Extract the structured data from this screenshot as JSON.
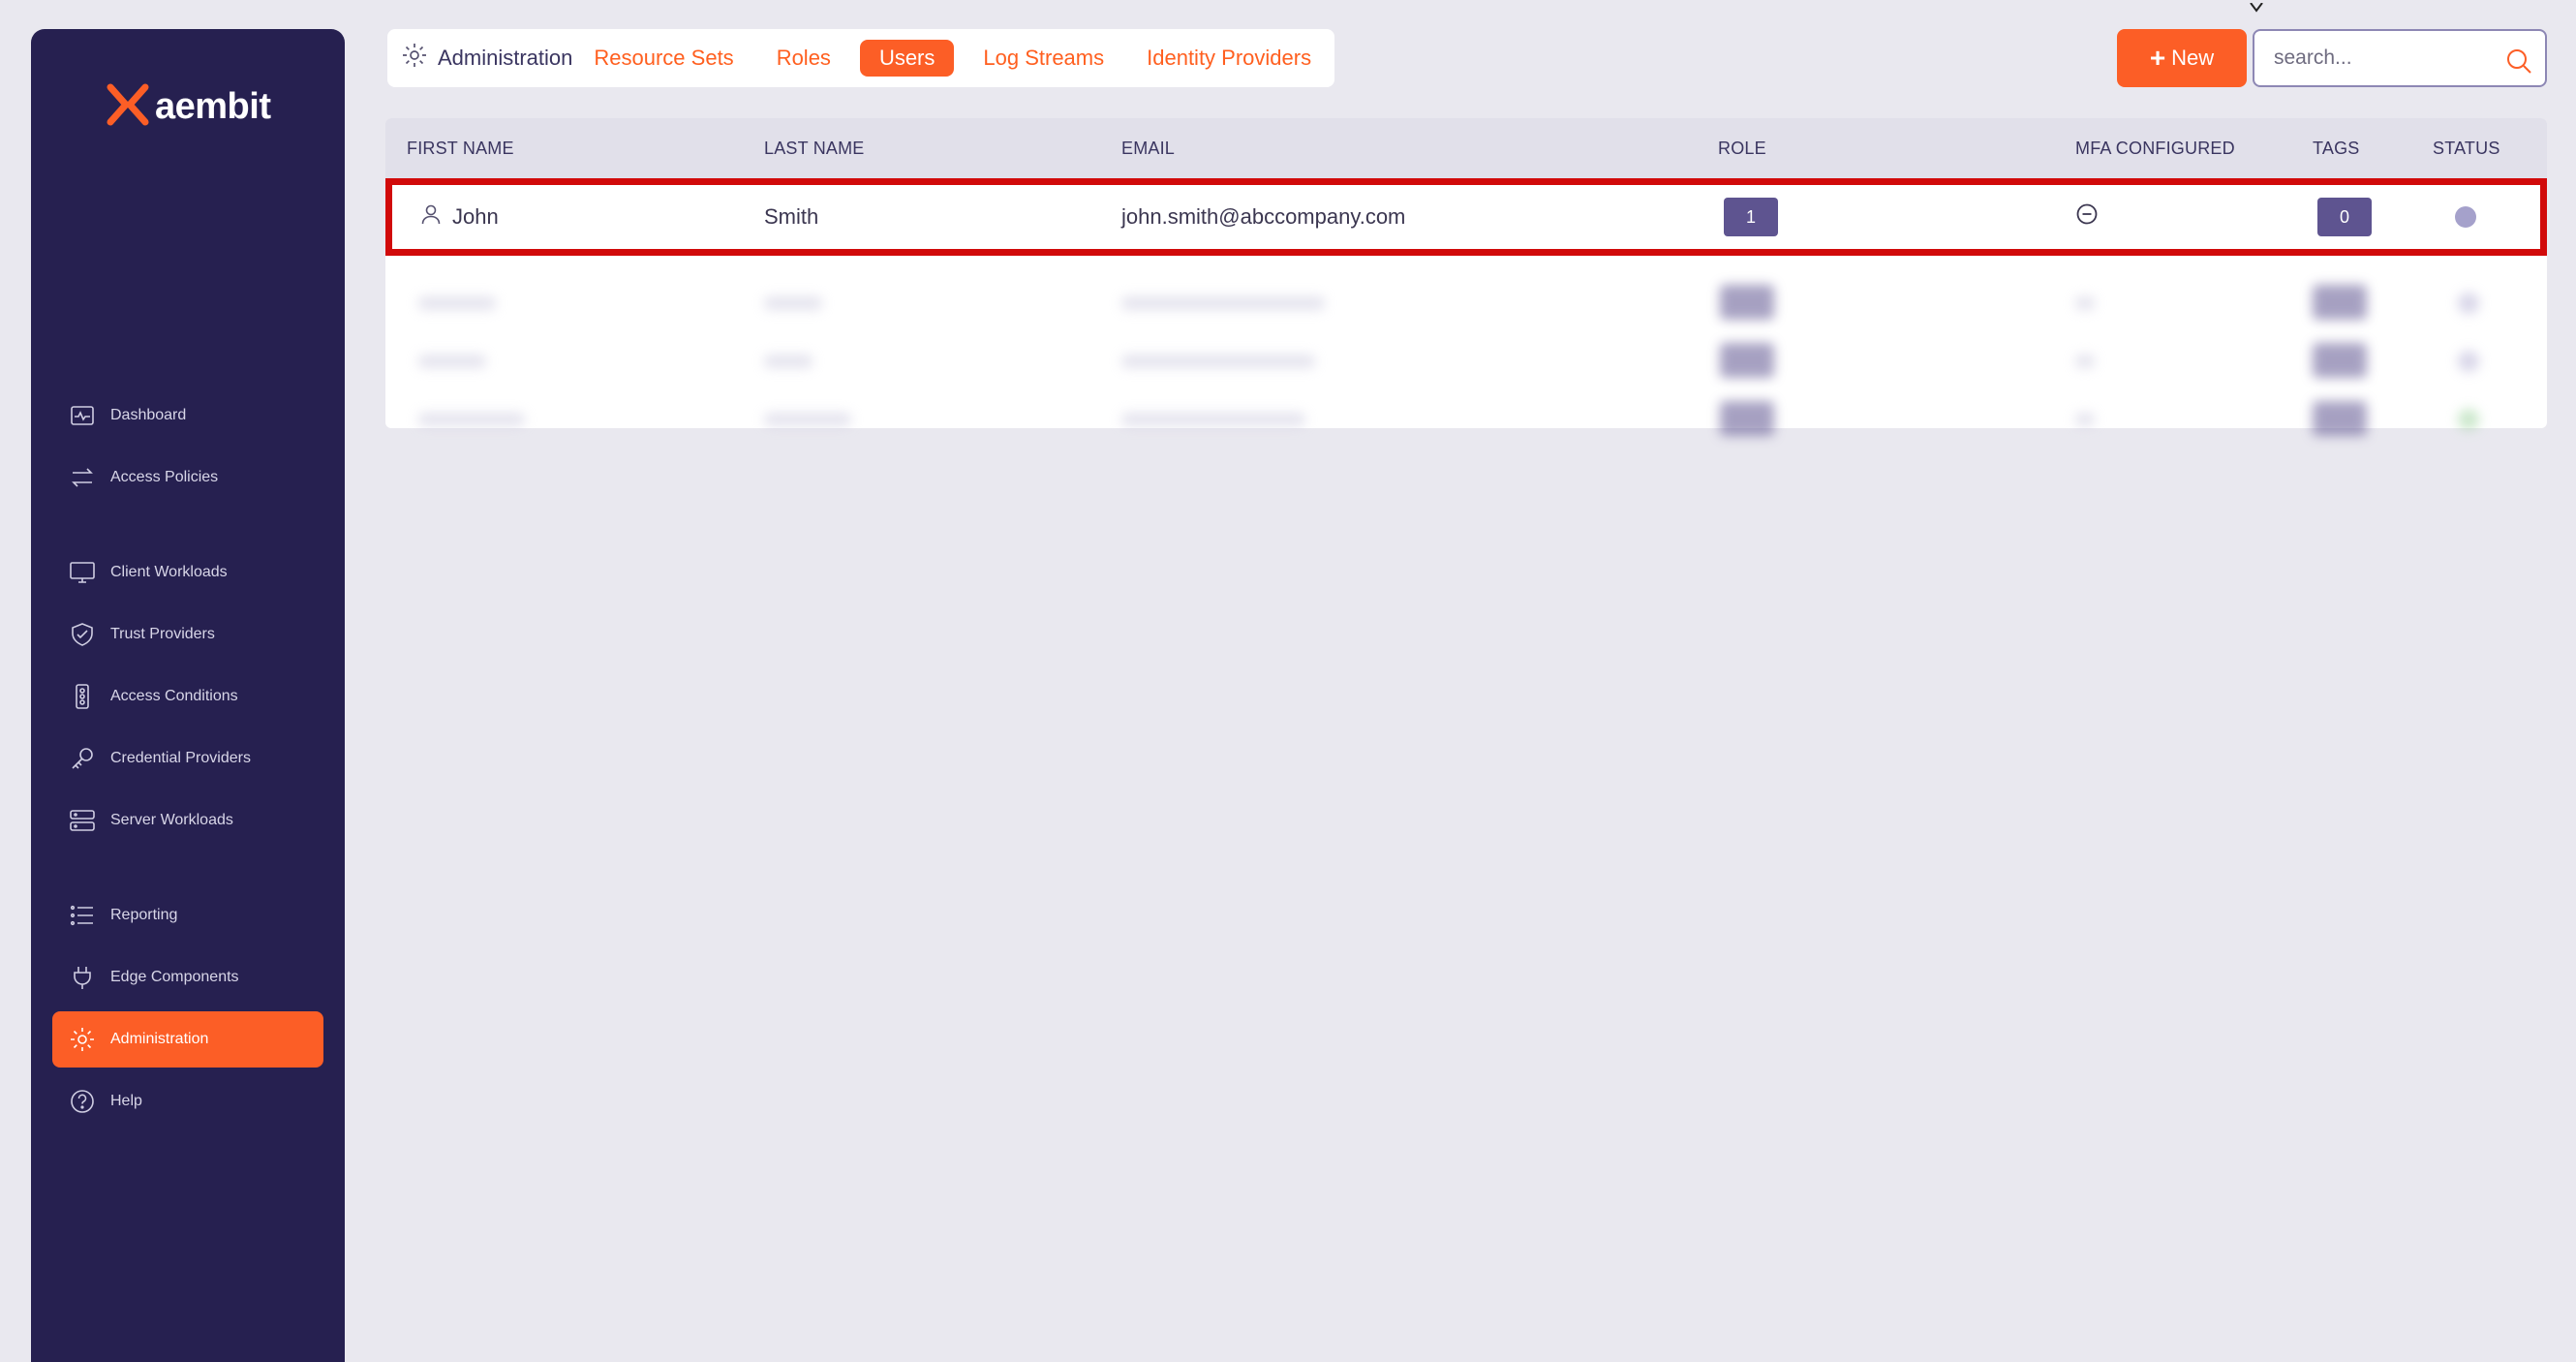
{
  "brand": {
    "name": "aembit"
  },
  "sidebar": {
    "items": [
      {
        "label": "Dashboard",
        "icon": "dashboard-icon"
      },
      {
        "label": "Access Policies",
        "icon": "arrows-exchange-icon"
      },
      {
        "label": "Client Workloads",
        "icon": "monitor-icon"
      },
      {
        "label": "Trust Providers",
        "icon": "shield-check-icon"
      },
      {
        "label": "Access Conditions",
        "icon": "traffic-light-icon"
      },
      {
        "label": "Credential Providers",
        "icon": "key-icon"
      },
      {
        "label": "Server Workloads",
        "icon": "server-icon"
      },
      {
        "label": "Reporting",
        "icon": "list-icon"
      },
      {
        "label": "Edge Components",
        "icon": "plug-icon"
      },
      {
        "label": "Administration",
        "icon": "gear-icon",
        "active": true
      },
      {
        "label": "Help",
        "icon": "help-circle-icon"
      }
    ]
  },
  "tabs": {
    "section": "Administration",
    "items": [
      {
        "label": "Resource Sets"
      },
      {
        "label": "Roles"
      },
      {
        "label": "Users",
        "active": true
      },
      {
        "label": "Log Streams"
      },
      {
        "label": "Identity Providers"
      }
    ]
  },
  "toolbar": {
    "new_label": "New",
    "search_placeholder": "search..."
  },
  "table": {
    "columns": [
      "FIRST NAME",
      "LAST NAME",
      "EMAIL",
      "ROLE",
      "MFA CONFIGURED",
      "TAGS",
      "STATUS"
    ],
    "rows": [
      {
        "first_name": "John",
        "last_name": "Smith",
        "email": "john.smith@abccompany.com",
        "role_count": "1",
        "mfa": "minus-circle-icon",
        "tags_count": "0",
        "status_color": "#a5a1cb"
      }
    ]
  },
  "colors": {
    "accent": "#fc5e26",
    "sidebar_bg": "#262050",
    "badge": "#5e5490",
    "highlight_border": "#d10a0a",
    "page_bg": "#e9e8ef"
  }
}
